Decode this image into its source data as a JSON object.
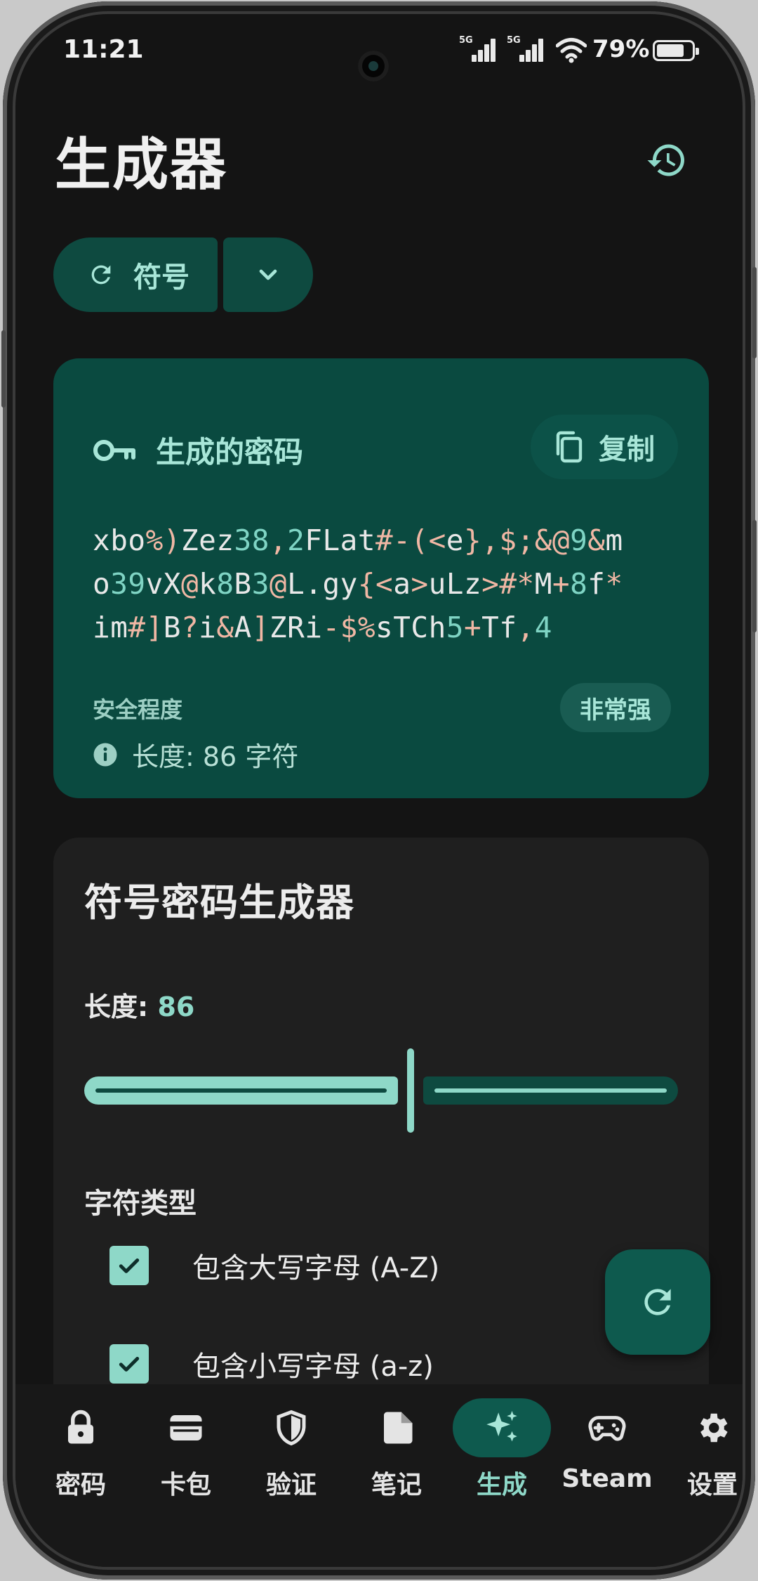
{
  "status_bar": {
    "time": "11:21",
    "network_1": "5G",
    "network_2": "5G",
    "battery_pct": "79%",
    "battery_level": 0.79
  },
  "header": {
    "title": "生成器",
    "history_icon": "history-icon"
  },
  "type_selector": {
    "label": "符号",
    "icon": "refresh-icon",
    "dropdown_icon": "chevron-down-icon"
  },
  "password_card": {
    "title": "生成的密码",
    "copy_label": "复制",
    "password_lines": [
      "xbo%)Zez38,2FLat#-(<e},$;&@9&m",
      "o39vX@k8B3@L.gy{<a>uLz>#*M+8f*",
      "im#]B?i&A]ZRi-$%sTCh5+Tf,4"
    ],
    "strength_label": "安全程度",
    "strength_value": "非常强",
    "length_text": "长度: 86 字符"
  },
  "generator": {
    "title": "符号密码生成器",
    "length_label": "长度: ",
    "length_value": "86",
    "slider_fraction": 0.55,
    "charset_title": "字符类型",
    "options": [
      {
        "label": "包含大写字母 (A-Z)",
        "checked": true
      },
      {
        "label": "包含小写字母 (a-z)",
        "checked": true
      }
    ]
  },
  "fab_icon": "refresh-icon",
  "nav": {
    "items": [
      {
        "label": "密码",
        "icon": "lock-icon",
        "active": false
      },
      {
        "label": "卡包",
        "icon": "wallet-icon",
        "active": false
      },
      {
        "label": "验证",
        "icon": "shield-icon",
        "active": false
      },
      {
        "label": "笔记",
        "icon": "note-icon",
        "active": false
      },
      {
        "label": "生成",
        "icon": "sparkle-icon",
        "active": true
      },
      {
        "label": "Steam",
        "icon": "gamepad-icon",
        "active": false
      },
      {
        "label": "设置",
        "icon": "gear-icon",
        "active": false
      }
    ]
  },
  "colors": {
    "background": "#141414",
    "card_accent": "#0a4a40",
    "accent": "#8ed8c8",
    "accent_text": "#a8e6d8",
    "number_highlight": "#7fd4c4",
    "symbol_highlight": "#f0b7a4"
  }
}
